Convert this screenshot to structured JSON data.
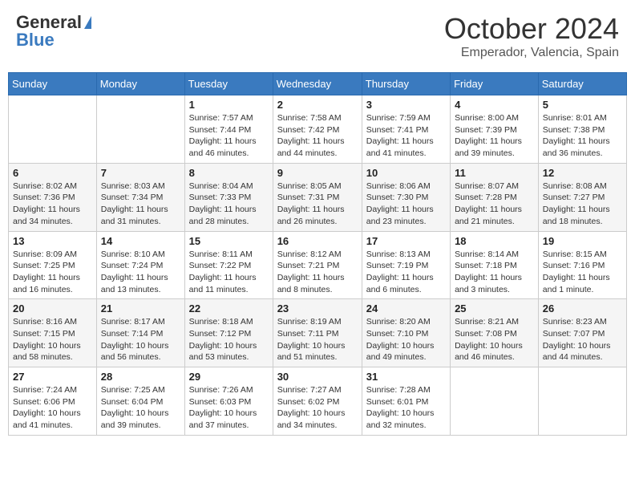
{
  "header": {
    "logo_general": "General",
    "logo_blue": "Blue",
    "month": "October 2024",
    "location": "Emperador, Valencia, Spain"
  },
  "weekdays": [
    "Sunday",
    "Monday",
    "Tuesday",
    "Wednesday",
    "Thursday",
    "Friday",
    "Saturday"
  ],
  "weeks": [
    [
      {
        "day": "",
        "info": ""
      },
      {
        "day": "",
        "info": ""
      },
      {
        "day": "1",
        "info": "Sunrise: 7:57 AM\nSunset: 7:44 PM\nDaylight: 11 hours and 46 minutes."
      },
      {
        "day": "2",
        "info": "Sunrise: 7:58 AM\nSunset: 7:42 PM\nDaylight: 11 hours and 44 minutes."
      },
      {
        "day": "3",
        "info": "Sunrise: 7:59 AM\nSunset: 7:41 PM\nDaylight: 11 hours and 41 minutes."
      },
      {
        "day": "4",
        "info": "Sunrise: 8:00 AM\nSunset: 7:39 PM\nDaylight: 11 hours and 39 minutes."
      },
      {
        "day": "5",
        "info": "Sunrise: 8:01 AM\nSunset: 7:38 PM\nDaylight: 11 hours and 36 minutes."
      }
    ],
    [
      {
        "day": "6",
        "info": "Sunrise: 8:02 AM\nSunset: 7:36 PM\nDaylight: 11 hours and 34 minutes."
      },
      {
        "day": "7",
        "info": "Sunrise: 8:03 AM\nSunset: 7:34 PM\nDaylight: 11 hours and 31 minutes."
      },
      {
        "day": "8",
        "info": "Sunrise: 8:04 AM\nSunset: 7:33 PM\nDaylight: 11 hours and 28 minutes."
      },
      {
        "day": "9",
        "info": "Sunrise: 8:05 AM\nSunset: 7:31 PM\nDaylight: 11 hours and 26 minutes."
      },
      {
        "day": "10",
        "info": "Sunrise: 8:06 AM\nSunset: 7:30 PM\nDaylight: 11 hours and 23 minutes."
      },
      {
        "day": "11",
        "info": "Sunrise: 8:07 AM\nSunset: 7:28 PM\nDaylight: 11 hours and 21 minutes."
      },
      {
        "day": "12",
        "info": "Sunrise: 8:08 AM\nSunset: 7:27 PM\nDaylight: 11 hours and 18 minutes."
      }
    ],
    [
      {
        "day": "13",
        "info": "Sunrise: 8:09 AM\nSunset: 7:25 PM\nDaylight: 11 hours and 16 minutes."
      },
      {
        "day": "14",
        "info": "Sunrise: 8:10 AM\nSunset: 7:24 PM\nDaylight: 11 hours and 13 minutes."
      },
      {
        "day": "15",
        "info": "Sunrise: 8:11 AM\nSunset: 7:22 PM\nDaylight: 11 hours and 11 minutes."
      },
      {
        "day": "16",
        "info": "Sunrise: 8:12 AM\nSunset: 7:21 PM\nDaylight: 11 hours and 8 minutes."
      },
      {
        "day": "17",
        "info": "Sunrise: 8:13 AM\nSunset: 7:19 PM\nDaylight: 11 hours and 6 minutes."
      },
      {
        "day": "18",
        "info": "Sunrise: 8:14 AM\nSunset: 7:18 PM\nDaylight: 11 hours and 3 minutes."
      },
      {
        "day": "19",
        "info": "Sunrise: 8:15 AM\nSunset: 7:16 PM\nDaylight: 11 hours and 1 minute."
      }
    ],
    [
      {
        "day": "20",
        "info": "Sunrise: 8:16 AM\nSunset: 7:15 PM\nDaylight: 10 hours and 58 minutes."
      },
      {
        "day": "21",
        "info": "Sunrise: 8:17 AM\nSunset: 7:14 PM\nDaylight: 10 hours and 56 minutes."
      },
      {
        "day": "22",
        "info": "Sunrise: 8:18 AM\nSunset: 7:12 PM\nDaylight: 10 hours and 53 minutes."
      },
      {
        "day": "23",
        "info": "Sunrise: 8:19 AM\nSunset: 7:11 PM\nDaylight: 10 hours and 51 minutes."
      },
      {
        "day": "24",
        "info": "Sunrise: 8:20 AM\nSunset: 7:10 PM\nDaylight: 10 hours and 49 minutes."
      },
      {
        "day": "25",
        "info": "Sunrise: 8:21 AM\nSunset: 7:08 PM\nDaylight: 10 hours and 46 minutes."
      },
      {
        "day": "26",
        "info": "Sunrise: 8:23 AM\nSunset: 7:07 PM\nDaylight: 10 hours and 44 minutes."
      }
    ],
    [
      {
        "day": "27",
        "info": "Sunrise: 7:24 AM\nSunset: 6:06 PM\nDaylight: 10 hours and 41 minutes."
      },
      {
        "day": "28",
        "info": "Sunrise: 7:25 AM\nSunset: 6:04 PM\nDaylight: 10 hours and 39 minutes."
      },
      {
        "day": "29",
        "info": "Sunrise: 7:26 AM\nSunset: 6:03 PM\nDaylight: 10 hours and 37 minutes."
      },
      {
        "day": "30",
        "info": "Sunrise: 7:27 AM\nSunset: 6:02 PM\nDaylight: 10 hours and 34 minutes."
      },
      {
        "day": "31",
        "info": "Sunrise: 7:28 AM\nSunset: 6:01 PM\nDaylight: 10 hours and 32 minutes."
      },
      {
        "day": "",
        "info": ""
      },
      {
        "day": "",
        "info": ""
      }
    ]
  ]
}
